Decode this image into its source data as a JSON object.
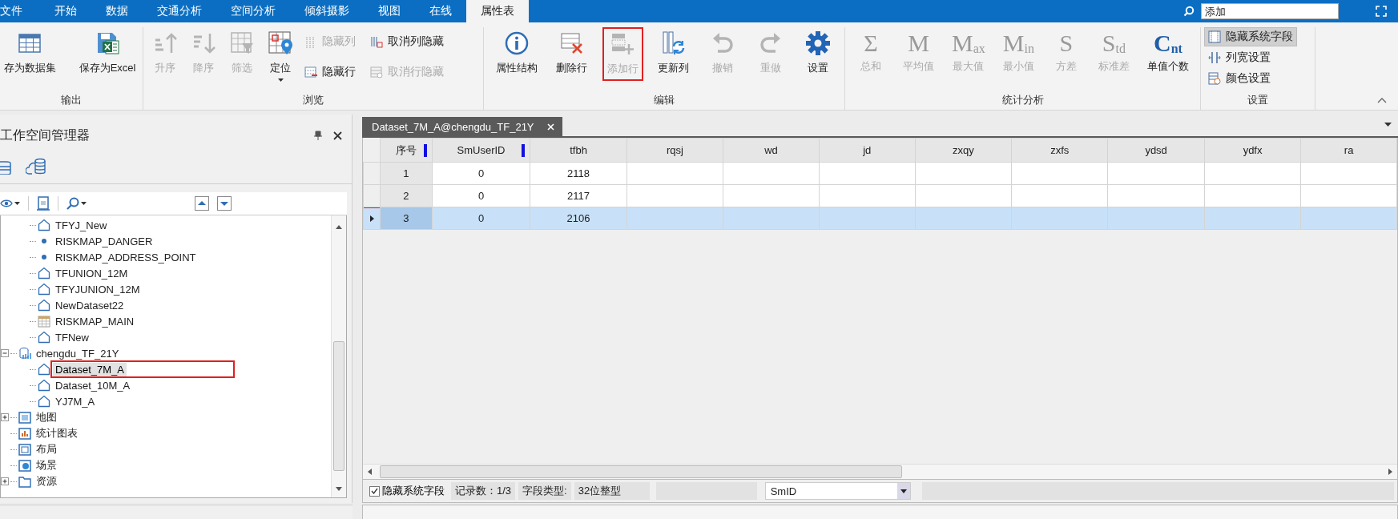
{
  "menu_tabs": [
    {
      "label": "文件",
      "selected": false
    },
    {
      "label": "开始",
      "selected": false
    },
    {
      "label": "数据",
      "selected": false
    },
    {
      "label": "交通分析",
      "selected": false
    },
    {
      "label": "空间分析",
      "selected": false
    },
    {
      "label": "倾斜摄影",
      "selected": false
    },
    {
      "label": "视图",
      "selected": false
    },
    {
      "label": "在线",
      "selected": false
    },
    {
      "label": "属性表",
      "selected": true
    }
  ],
  "search": {
    "value": "添加"
  },
  "ribbon": {
    "groups": [
      {
        "label": "输出",
        "items": [
          {
            "kind": "large",
            "label": "存为数据集",
            "disabled": false
          },
          {
            "kind": "large",
            "label": "保存为Excel",
            "disabled": false
          }
        ]
      },
      {
        "label": "浏览",
        "items": [
          {
            "kind": "large",
            "label": "升序",
            "disabled": true
          },
          {
            "kind": "large",
            "label": "降序",
            "disabled": true
          },
          {
            "kind": "large",
            "label": "筛选",
            "disabled": true
          },
          {
            "kind": "dropdown",
            "label": "定位",
            "disabled": false
          },
          {
            "kind": "small",
            "label": "隐藏列",
            "disabled": true
          },
          {
            "kind": "small",
            "label": "隐藏行",
            "disabled": false
          },
          {
            "kind": "small",
            "label": "取消列隐藏",
            "disabled": false
          },
          {
            "kind": "small",
            "label": "取消行隐藏",
            "disabled": true
          }
        ]
      },
      {
        "label": "编辑",
        "items": [
          {
            "kind": "large",
            "label": "属性结构",
            "disabled": false,
            "annotated": false
          },
          {
            "kind": "large",
            "label": "删除行",
            "disabled": false,
            "annotated": false
          },
          {
            "kind": "large",
            "label": "添加行",
            "disabled": true,
            "annotated": true
          },
          {
            "kind": "large",
            "label": "更新列",
            "disabled": false,
            "annotated": false
          },
          {
            "kind": "large",
            "label": "撤销",
            "disabled": true,
            "annotated": false
          },
          {
            "kind": "large",
            "label": "重做",
            "disabled": true,
            "annotated": false
          },
          {
            "kind": "large",
            "label": "设置",
            "disabled": false,
            "annotated": false
          }
        ]
      },
      {
        "label": "统计分析",
        "items": [
          {
            "kind": "stat",
            "glyph": "Σ",
            "label": "总和",
            "disabled": true
          },
          {
            "kind": "stat",
            "glyph": "M",
            "label": "平均值",
            "disabled": true
          },
          {
            "kind": "stat",
            "glyph": "M$_{ax}$",
            "label": "最大值",
            "disabled": true
          },
          {
            "kind": "stat",
            "glyph": "M$_{in}$",
            "label": "最小值",
            "disabled": true
          },
          {
            "kind": "stat",
            "glyph": "S",
            "label": "方差",
            "disabled": true
          },
          {
            "kind": "stat",
            "glyph": "S$_{td}$",
            "label": "标准差",
            "disabled": true
          },
          {
            "kind": "stat",
            "glyph": "C$_{nt}$",
            "label": "单值个数",
            "disabled": false
          }
        ]
      },
      {
        "label": "设置",
        "items": [
          {
            "kind": "toggle",
            "label": "隐藏系统字段",
            "selected": true
          },
          {
            "kind": "toggle",
            "label": "列宽设置",
            "selected": false
          },
          {
            "kind": "toggle",
            "label": "颜色设置",
            "selected": false
          }
        ]
      }
    ]
  },
  "workspace": {
    "title": "工作空间管理器",
    "tree": [
      {
        "children": [
          {
            "children": [
              {
                "label": "TFYJ_New",
                "kind": "region",
                "selected": false,
                "annotated": false
              },
              {
                "label": "RISKMAP_DANGER",
                "kind": "point",
                "selected": false,
                "annotated": false
              },
              {
                "label": "RISKMAP_ADDRESS_POINT",
                "kind": "point",
                "selected": false,
                "annotated": false
              },
              {
                "label": "TFUNION_12M",
                "kind": "region",
                "selected": false,
                "annotated": false
              },
              {
                "label": "TFYJUNION_12M",
                "kind": "region",
                "selected": false,
                "annotated": false
              },
              {
                "label": "NewDataset22",
                "kind": "region",
                "selected": false,
                "annotated": false
              },
              {
                "label": "RISKMAP_MAIN",
                "kind": "tabular",
                "selected": false,
                "annotated": false
              },
              {
                "label": "TFNew",
                "kind": "region",
                "selected": false,
                "annotated": false
              }
            ]
          },
          {
            "label": "chengdu_TF_21Y",
            "kind": "datasource",
            "expanded": true,
            "selected": false,
            "annotated": false,
            "children": [
              {
                "label": "Dataset_7M_A",
                "kind": "region",
                "selected": true,
                "annotated": true
              },
              {
                "label": "Dataset_10M_A",
                "kind": "region",
                "selected": false,
                "annotated": false
              },
              {
                "label": "YJ7M_A",
                "kind": "region",
                "selected": false,
                "annotated": false
              }
            ]
          }
        ]
      },
      {
        "label": "地图",
        "kind": "maps",
        "expanded": false,
        "selected": false,
        "annotated": false
      },
      {
        "label": "统计图表",
        "kind": "charts",
        "selected": false,
        "annotated": false
      },
      {
        "label": "布局",
        "kind": "layouts",
        "selected": false,
        "annotated": false
      },
      {
        "label": "场景",
        "kind": "scenes",
        "selected": false,
        "annotated": false
      },
      {
        "label": "资源",
        "kind": "resources",
        "expanded": false,
        "selected": false,
        "annotated": false
      }
    ]
  },
  "document": {
    "tab": "Dataset_7M_A@chengdu_TF_21Y",
    "table": {
      "columns": [
        {
          "label": "序号",
          "frozen": true
        },
        {
          "label": "SmUserID",
          "frozen": true
        },
        {
          "label": "tfbh",
          "frozen": false
        },
        {
          "label": "rqsj",
          "frozen": false
        },
        {
          "label": "wd",
          "frozen": false
        },
        {
          "label": "jd",
          "frozen": false
        },
        {
          "label": "zxqy",
          "frozen": false
        },
        {
          "label": "zxfs",
          "frozen": false
        },
        {
          "label": "ydsd",
          "frozen": false
        },
        {
          "label": "ydfx",
          "frozen": false
        },
        {
          "label": "ra",
          "frozen": false
        }
      ],
      "rows": [
        {
          "cells": [
            "1",
            "0",
            "2118"
          ],
          "selected": false,
          "annotated": false
        },
        {
          "cells": [
            "2",
            "0",
            "2117"
          ],
          "selected": false,
          "annotated": false
        },
        {
          "cells": [
            "3",
            "0",
            "2106"
          ],
          "selected": true,
          "annotated": true
        }
      ]
    }
  },
  "status_bar": {
    "hide_system_fields": {
      "label": "隐藏系统字段",
      "checked": true
    },
    "record_count": "记录数：1/3",
    "field_type_label": "字段类型:",
    "field_type": "32位整型",
    "field_select": "SmID"
  }
}
